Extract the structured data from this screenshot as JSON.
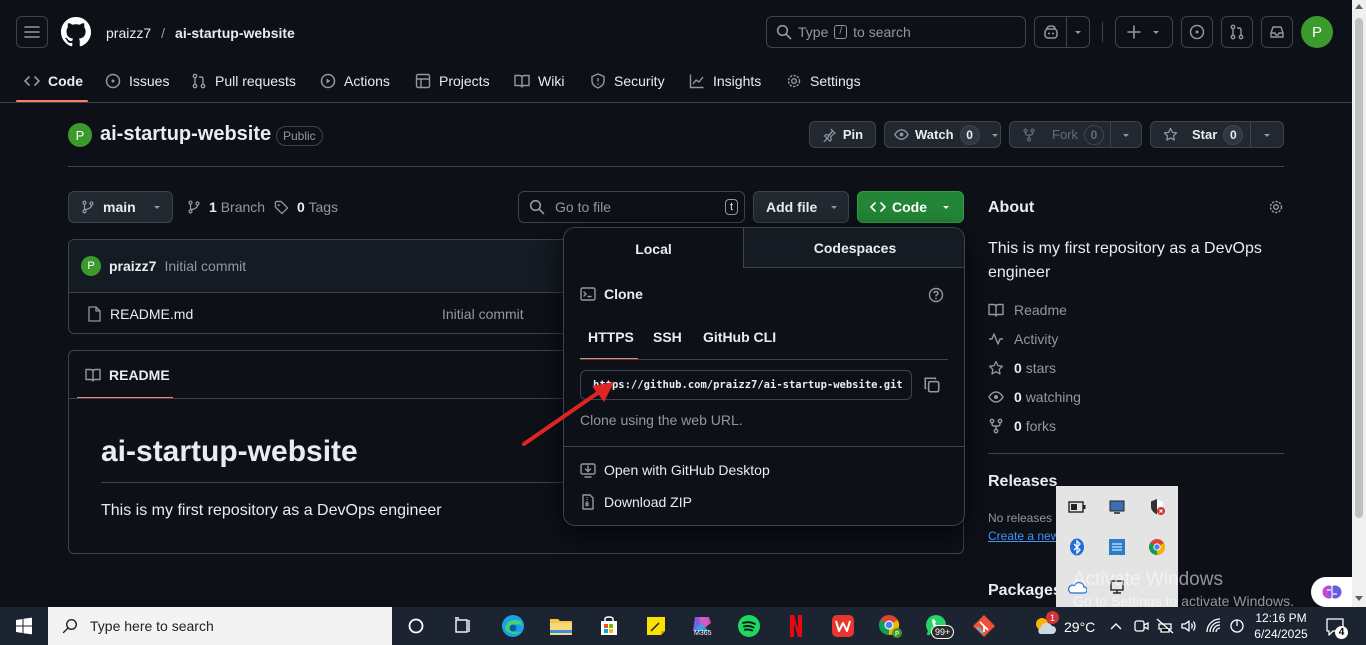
{
  "header": {
    "owner": "praizz7",
    "slash": "/",
    "repo": "ai-startup-website",
    "search_placeholder_pre": "Type",
    "search_key": "/",
    "search_placeholder_post": "to search",
    "avatar_letter": "P"
  },
  "nav": {
    "code": "Code",
    "issues": "Issues",
    "pulls": "Pull requests",
    "actions": "Actions",
    "projects": "Projects",
    "wiki": "Wiki",
    "security": "Security",
    "insights": "Insights",
    "settings": "Settings"
  },
  "repo_header": {
    "avatar_letter": "P",
    "name": "ai-startup-website",
    "visibility": "Public",
    "pin": "Pin",
    "watch": "Watch",
    "watch_count": "0",
    "fork": "Fork",
    "fork_count": "0",
    "star": "Star",
    "star_count": "0"
  },
  "toolbar": {
    "branch": "main",
    "branches_count": "1",
    "branches_label": "Branch",
    "tags_count": "0",
    "tags_label": "Tags",
    "go_to_file": "Go to file",
    "go_to_file_key": "t",
    "add_file": "Add file",
    "code": "Code"
  },
  "commit": {
    "avatar_letter": "P",
    "author": "praizz7",
    "message": "Initial commit"
  },
  "files": [
    {
      "name": "README.md",
      "message": "Initial commit"
    }
  ],
  "readme": {
    "tab": "README",
    "title": "ai-startup-website",
    "body": "This is my first repository as a DevOps engineer"
  },
  "clone_popup": {
    "tab_local": "Local",
    "tab_codespaces": "Codespaces",
    "clone_title": "Clone",
    "proto_https": "HTTPS",
    "proto_ssh": "SSH",
    "proto_cli": "GitHub CLI",
    "url": "https://github.com/praizz7/ai-startup-website.git",
    "hint": "Clone using the web URL.",
    "open_desktop": "Open with GitHub Desktop",
    "download_zip": "Download ZIP"
  },
  "about": {
    "title": "About",
    "description": "This is my first repository as a DevOps engineer",
    "readme": "Readme",
    "activity": "Activity",
    "stars_count": "0",
    "stars_label": "stars",
    "watching_count": "0",
    "watching_label": "watching",
    "forks_count": "0",
    "forks_label": "forks",
    "releases_title": "Releases",
    "no_releases": "No releases p",
    "create_release": "Create a new",
    "packages_title": "Packages"
  },
  "watermark": {
    "line1": "Activate Windows",
    "line2": "Go to Settings to activate Windows."
  },
  "taskbar": {
    "search_placeholder": "Type here to search",
    "m365_label": "M365",
    "whatsapp_badge": "99+",
    "weather_badge": "1",
    "temperature": "29°C",
    "time": "12:16 PM",
    "date": "6/24/2025",
    "notification_count": "4"
  },
  "colors": {
    "bg": "#0d1117",
    "border": "#3d444d",
    "muted": "#9198a1",
    "green_button": "#238636",
    "accent_underline": "#f78166",
    "link": "#4493f8",
    "arrow": "#e02424",
    "avatar_green": "#3b9a2c"
  }
}
